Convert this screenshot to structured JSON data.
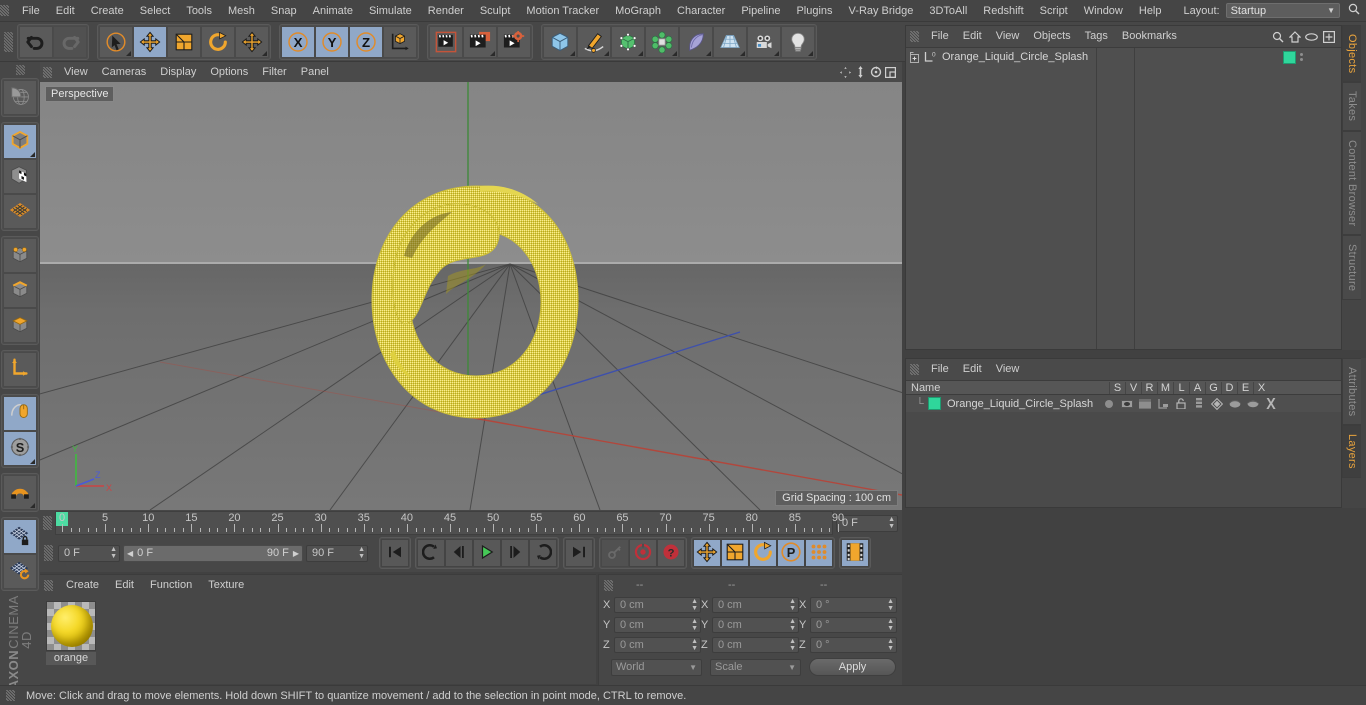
{
  "app": {
    "brand_line1": "MAXON",
    "brand_line2": "CINEMA 4D"
  },
  "menubar": {
    "items": [
      "File",
      "Edit",
      "Create",
      "Select",
      "Tools",
      "Mesh",
      "Snap",
      "Animate",
      "Simulate",
      "Render",
      "Sculpt",
      "Motion Tracker",
      "MoGraph",
      "Character",
      "Pipeline",
      "Plugins",
      "V-Ray Bridge",
      "3DToAll",
      "Redshift",
      "Script",
      "Window",
      "Help"
    ],
    "layout_label": "Layout:",
    "layout_value": "Startup",
    "search_icon": "search-icon"
  },
  "toolbar": {
    "groups": [
      {
        "name": "history",
        "buttons": [
          {
            "name": "undo-button",
            "icon": "undo-icon",
            "selected": false,
            "disabled": false
          },
          {
            "name": "redo-button",
            "icon": "redo-icon",
            "selected": false,
            "disabled": true
          }
        ]
      },
      {
        "name": "tools",
        "buttons": [
          {
            "name": "live-selection-tool",
            "icon": "cursor-circle-icon",
            "selected": false,
            "disabled": false,
            "corner": true
          },
          {
            "name": "move-tool",
            "icon": "move-arrows-icon",
            "selected": true,
            "disabled": false
          },
          {
            "name": "scale-tool",
            "icon": "scale-box-icon",
            "selected": false,
            "disabled": false
          },
          {
            "name": "rotate-tool",
            "icon": "rotate-arc-icon",
            "selected": false,
            "disabled": false
          },
          {
            "name": "transform-tool",
            "icon": "move-arrows-icon",
            "selected": false,
            "disabled": false,
            "corner": true
          }
        ]
      },
      {
        "name": "axis-locks",
        "buttons": [
          {
            "name": "lock-x-axis-button",
            "icon": "x-axis-icon",
            "selected": true,
            "disabled": false
          },
          {
            "name": "lock-y-axis-button",
            "icon": "y-axis-icon",
            "selected": true,
            "disabled": false
          },
          {
            "name": "lock-z-axis-button",
            "icon": "z-axis-icon",
            "selected": true,
            "disabled": false
          },
          {
            "name": "world-object-coordinates-button",
            "icon": "world-axis-cube-icon",
            "selected": false,
            "disabled": false
          }
        ]
      },
      {
        "name": "render",
        "buttons": [
          {
            "name": "render-view-button",
            "icon": "clapperboard-frame-icon",
            "selected": false,
            "disabled": false
          },
          {
            "name": "render-to-picture-viewer-button",
            "icon": "clapperboard-window-icon",
            "selected": false,
            "disabled": false,
            "corner": true
          },
          {
            "name": "render-settings-button",
            "icon": "clapperboard-gear-icon",
            "selected": false,
            "disabled": false
          }
        ]
      },
      {
        "name": "creation",
        "buttons": [
          {
            "name": "add-cube-button",
            "icon": "cube-icon",
            "selected": false,
            "disabled": false,
            "corner": true
          },
          {
            "name": "add-spline-button",
            "icon": "pen-spline-icon",
            "selected": false,
            "disabled": false,
            "corner": true
          },
          {
            "name": "add-nurbs-button",
            "icon": "green-cube-cage-icon",
            "selected": false,
            "disabled": false,
            "corner": true
          },
          {
            "name": "add-array-button",
            "icon": "green-cluster-icon",
            "selected": false,
            "disabled": false,
            "corner": true
          },
          {
            "name": "add-deformer-button",
            "icon": "bend-deformer-icon",
            "selected": false,
            "disabled": false,
            "corner": true
          },
          {
            "name": "add-environment-button",
            "icon": "floor-grid-icon",
            "selected": false,
            "disabled": false,
            "corner": true
          },
          {
            "name": "add-camera-button",
            "icon": "camera-icon",
            "selected": false,
            "disabled": false,
            "corner": true
          },
          {
            "name": "add-light-button",
            "icon": "light-bulb-icon",
            "selected": false,
            "disabled": false,
            "corner": true
          }
        ]
      }
    ]
  },
  "left_toolbar": {
    "buttons": [
      {
        "name": "undo-view-button",
        "icon": "globe-wire-icon",
        "selected": false
      },
      {
        "name": "model-mode-button",
        "icon": "gray-cube-icon",
        "selected": true,
        "corner": true
      },
      {
        "name": "texture-mode-button",
        "icon": "checker-cube-icon",
        "selected": false
      },
      {
        "name": "workplane-mode-button",
        "icon": "orange-grid-plane-icon",
        "selected": false
      },
      {
        "name": "points-mode-button",
        "icon": "point-cube-icon",
        "selected": false
      },
      {
        "name": "edges-mode-button",
        "icon": "edge-cube-icon",
        "selected": false
      },
      {
        "name": "polygons-mode-button",
        "icon": "polygon-cube-icon",
        "selected": false
      },
      {
        "name": "object-axis-button",
        "icon": "axis-arrow-icon",
        "selected": false
      },
      {
        "name": "enable-snapping-button",
        "icon": "mouse-spline-icon",
        "selected": true
      },
      {
        "name": "soft-selection-button",
        "icon": "s-compass-icon",
        "selected": true,
        "corner": true
      },
      {
        "name": "magnet-tool-button",
        "icon": "magnet-icon",
        "selected": false,
        "corner": true
      },
      {
        "name": "lock-workplane-button",
        "icon": "grid-lock-icon",
        "selected": true
      },
      {
        "name": "planar-workplane-button",
        "icon": "grid-rotate-icon",
        "selected": false
      }
    ]
  },
  "viewport": {
    "menu": [
      "View",
      "Cameras",
      "Display",
      "Options",
      "Filter",
      "Panel"
    ],
    "corner_icons": [
      "move-view-icon",
      "pan-view-icon",
      "rotate-view-icon",
      "maximize-view-icon"
    ],
    "label": "Perspective",
    "grid_spacing": "Grid Spacing : 100 cm",
    "axis_labels": {
      "x": "X",
      "y": "Y",
      "z": "Z"
    },
    "scene_object": "Orange_Liquid_Circle_Splash",
    "object_color": "#e2cf3f"
  },
  "timeline": {
    "ruler_labels": [
      "0",
      "5",
      "10",
      "15",
      "20",
      "25",
      "30",
      "35",
      "40",
      "45",
      "50",
      "55",
      "60",
      "65",
      "70",
      "75",
      "80",
      "85",
      "90"
    ],
    "frame_min": 0,
    "frame_max": 90,
    "current_frame_right": "0 F",
    "current_frame_field": "0 F",
    "range_start": "0 F",
    "range_end": "90 F",
    "preview_end": "90 F",
    "playhead_color": "#4ddba2",
    "buttons": [
      {
        "name": "go-to-start-button",
        "icon": "skip-start-icon",
        "selected": false,
        "disabled": false
      },
      {
        "name": "go-to-previous-key-button",
        "icon": "prev-key-icon",
        "selected": false,
        "disabled": false
      },
      {
        "name": "go-to-previous-frame-button",
        "icon": "step-back-icon",
        "selected": false,
        "disabled": false
      },
      {
        "name": "play-button",
        "icon": "play-icon",
        "selected": false,
        "disabled": false
      },
      {
        "name": "go-to-next-frame-button",
        "icon": "step-forward-icon",
        "selected": false,
        "disabled": false
      },
      {
        "name": "go-to-next-key-button",
        "icon": "next-key-icon",
        "selected": false,
        "disabled": false
      },
      {
        "name": "go-to-end-button",
        "icon": "skip-end-icon",
        "selected": false,
        "disabled": false
      },
      {
        "name": "record-active-objects-button",
        "icon": "key-icon",
        "selected": false,
        "disabled": true
      },
      {
        "name": "autokeying-button",
        "icon": "red-record-icon",
        "selected": false,
        "disabled": false
      },
      {
        "name": "keyframe-selection-button",
        "icon": "red-question-icon",
        "selected": false,
        "disabled": false
      },
      {
        "name": "position-key-button",
        "icon": "move-arrows-icon",
        "selected": true,
        "disabled": false
      },
      {
        "name": "scale-key-button",
        "icon": "scale-box-icon",
        "selected": true,
        "disabled": false
      },
      {
        "name": "rotation-key-button",
        "icon": "rotate-arc-icon",
        "selected": true,
        "disabled": false
      },
      {
        "name": "pla-key-button",
        "icon": "p-circle-icon",
        "selected": true,
        "disabled": false
      },
      {
        "name": "point-level-animation-button",
        "icon": "dot-grid-icon",
        "selected": true,
        "disabled": false
      },
      {
        "name": "timeline-view-button",
        "icon": "film-strip-icon",
        "selected": true,
        "disabled": false
      }
    ]
  },
  "material_manager": {
    "menu": [
      "Create",
      "Edit",
      "Function",
      "Texture"
    ],
    "materials": [
      {
        "name": "orange",
        "color": "#f2d62a"
      }
    ]
  },
  "coordinates": {
    "headers": [
      "--",
      "--",
      "--"
    ],
    "rows": [
      {
        "axis": "X",
        "position": "0 cm",
        "size": "0 cm",
        "rotation": "0 °"
      },
      {
        "axis": "Y",
        "position": "0 cm",
        "size": "0 cm",
        "rotation": "0 °"
      },
      {
        "axis": "Z",
        "position": "0 cm",
        "size": "0 cm",
        "rotation": "0 °"
      }
    ],
    "coord_system": "World",
    "size_mode": "Scale",
    "apply_label": "Apply"
  },
  "object_manager": {
    "menu": [
      "File",
      "Edit",
      "View",
      "Objects",
      "Tags",
      "Bookmarks"
    ],
    "header_icons": [
      "search-icon",
      "home-icon",
      "eye-icon",
      "plus-box-icon"
    ],
    "rows": [
      {
        "name": "Orange_Liquid_Circle_Splash",
        "layer_color": "#2fd69b",
        "expandable": true,
        "level_badge": "0"
      }
    ]
  },
  "layer_manager": {
    "menu": [
      "File",
      "Edit",
      "View"
    ],
    "columns": [
      "Name",
      "S",
      "V",
      "R",
      "M",
      "L",
      "A",
      "G",
      "D",
      "E",
      "X"
    ],
    "rows": [
      {
        "name": "Orange_Liquid_Circle_Splash",
        "color": "#2fd69b",
        "flags": [
          "solo-dot-icon",
          "visible-icon",
          "render-icon",
          "manager-icon",
          "unlock-icon",
          "animation-icon",
          "generator-icon",
          "deformer-icon",
          "expression-icon",
          "xref-icon"
        ]
      }
    ]
  },
  "side_tabs": {
    "top": [
      {
        "label": "Objects",
        "active": true
      },
      {
        "label": "Takes",
        "active": false
      },
      {
        "label": "Content Browser",
        "active": false
      },
      {
        "label": "Structure",
        "active": false
      }
    ],
    "bottom": [
      {
        "label": "Attributes",
        "active": false
      },
      {
        "label": "Layers",
        "active": true
      }
    ]
  },
  "statusbar": {
    "text": "Move: Click and drag to move elements. Hold down SHIFT to quantize movement / add to the selection in point mode, CTRL to remove."
  }
}
